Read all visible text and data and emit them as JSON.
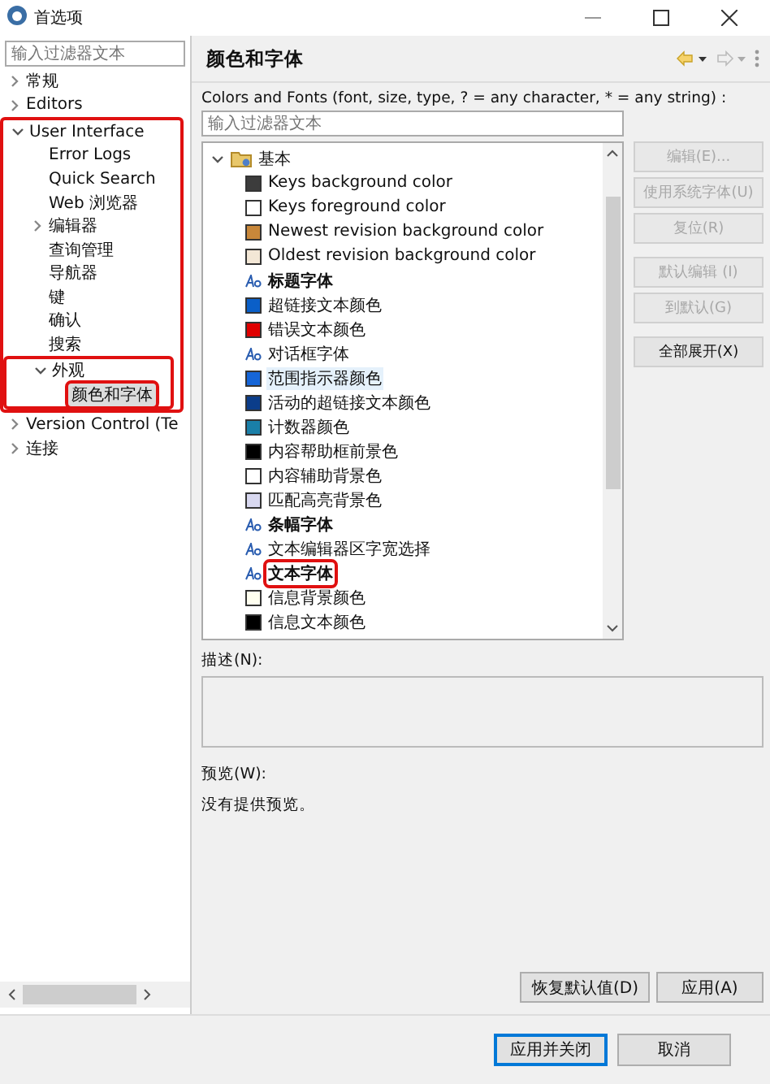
{
  "window": {
    "title": "首选项"
  },
  "sidebar": {
    "filter_placeholder": "输入过滤器文本",
    "tree": [
      {
        "label": "常规",
        "expanded": false
      },
      {
        "label": "Editors",
        "expanded": false
      },
      {
        "label": "User Interface",
        "expanded": true,
        "annotated": true,
        "children": [
          {
            "label": "Error Logs"
          },
          {
            "label": "Quick Search"
          },
          {
            "label": "Web 浏览器"
          },
          {
            "label": "编辑器",
            "expanded": false
          },
          {
            "label": "查询管理"
          },
          {
            "label": "导航器"
          },
          {
            "label": "键"
          },
          {
            "label": "确认"
          },
          {
            "label": "搜索"
          },
          {
            "label": "外观",
            "expanded": true,
            "annotated": true,
            "children": [
              {
                "label": "颜色和字体",
                "selected": true,
                "annotated": true
              }
            ]
          }
        ]
      },
      {
        "label": "Version Control (Te",
        "expanded": false
      },
      {
        "label": "连接",
        "expanded": false
      }
    ]
  },
  "page": {
    "title": "颜色和字体",
    "filter_label": "Colors and Fonts (font, size, type, ? = any character, * = any string) :",
    "filter_placeholder": "输入过滤器文本",
    "category": {
      "label": "基本",
      "expanded": true,
      "items": [
        {
          "kind": "color",
          "label": "Keys background color",
          "color": "#3c3c3c"
        },
        {
          "kind": "color",
          "label": "Keys foreground color",
          "color": "#ffffff"
        },
        {
          "kind": "color",
          "label": "Newest revision background color",
          "color": "#c8873a"
        },
        {
          "kind": "color",
          "label": "Oldest revision background color",
          "color": "#f3e7d6"
        },
        {
          "kind": "font",
          "label": "标题字体",
          "bold": true
        },
        {
          "kind": "color",
          "label": "超链接文本颜色",
          "color": "#0a5fc8"
        },
        {
          "kind": "color",
          "label": "错误文本颜色",
          "color": "#e00000"
        },
        {
          "kind": "font",
          "label": "对话框字体",
          "bold": false
        },
        {
          "kind": "color",
          "label": "范围指示器颜色",
          "color": "#1565d8",
          "hovered": true
        },
        {
          "kind": "color",
          "label": "活动的超链接文本颜色",
          "color": "#0b3d8a"
        },
        {
          "kind": "color",
          "label": "计数器颜色",
          "color": "#1a7fa8"
        },
        {
          "kind": "color",
          "label": "内容帮助框前景色",
          "color": "#000000"
        },
        {
          "kind": "color",
          "label": "内容辅助背景色",
          "color": "#ffffff"
        },
        {
          "kind": "color",
          "label": "匹配高亮背景色",
          "color": "#d8d8f0"
        },
        {
          "kind": "font",
          "label": "条幅字体",
          "bold": true
        },
        {
          "kind": "font",
          "label": "文本编辑器区字宽选择",
          "bold": false
        },
        {
          "kind": "font",
          "label": "文本字体",
          "bold": true,
          "annotated": true
        },
        {
          "kind": "color",
          "label": "信息背景颜色",
          "color": "#fffff0"
        },
        {
          "kind": "color",
          "label": "信息文本颜色",
          "color": "#000000"
        }
      ]
    },
    "side_buttons": [
      {
        "label": "编辑(E)...",
        "disabled": true
      },
      {
        "label": "使用系统字体(U)",
        "disabled": true
      },
      {
        "label": "复位(R)",
        "disabled": true
      },
      {
        "label": "默认编辑 (I)",
        "disabled": true
      },
      {
        "label": "到默认(G)",
        "disabled": true
      },
      {
        "label": "全部展开(X)",
        "disabled": false
      }
    ],
    "description_label": "描述(N):",
    "preview_label": "预览(W):",
    "preview_text": "没有提供预览。",
    "buttons": [
      "恢复默认值(D)",
      "应用(A)"
    ]
  },
  "footer": {
    "buttons": [
      {
        "label": "应用并关闭",
        "default": true
      },
      {
        "label": "取消",
        "default": false
      }
    ]
  }
}
